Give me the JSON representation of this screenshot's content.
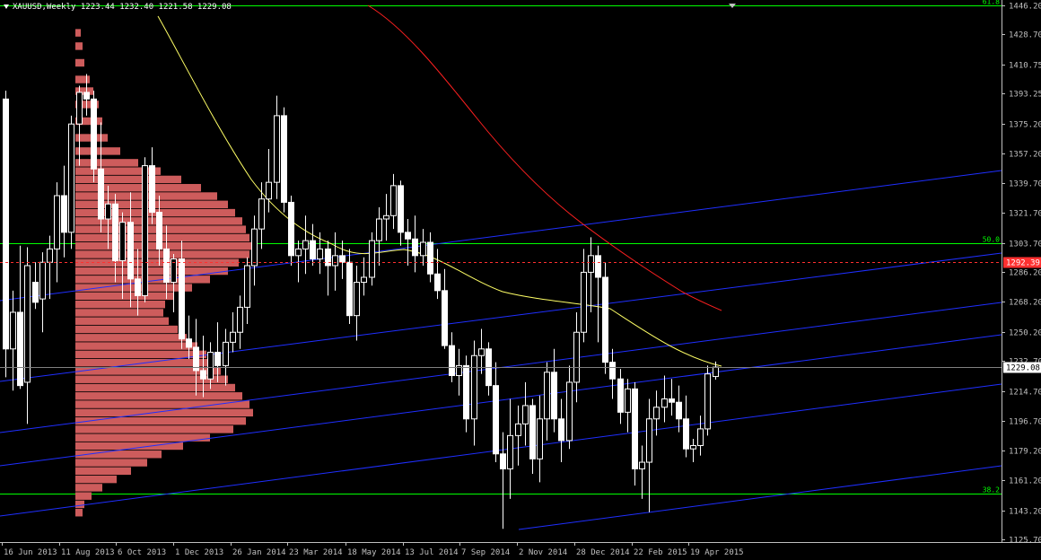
{
  "chart": {
    "symbol_line": "XAUUSD,Weekly  1223.44 1232.40 1221.58 1229.08",
    "colors": {
      "background": "#000000",
      "axis": "#c0c0c0",
      "candle": "#ffffff",
      "volume_profile": "#cd5c5c",
      "ma_fast": "#ffff66",
      "ma_slow": "#ff2020",
      "channel": "#1f2fff",
      "fib": "#00ff00",
      "current_price_line": "#808080",
      "red_dashed": "#ff3030"
    },
    "icons": [
      "dropdown-arrow-icon",
      "scroll-marker-icon"
    ]
  },
  "chart_data": {
    "type": "candlestick",
    "title": "XAUUSD,Weekly",
    "ohlc_last": {
      "open": 1223.44,
      "high": 1232.4,
      "low": 1221.58,
      "close": 1229.08
    },
    "ylim": [
      1125.7,
      1446.2
    ],
    "y_ticks": [
      "1446.20",
      "1428.70",
      "1410.75",
      "1393.25",
      "1375.20",
      "1357.20",
      "1339.70",
      "1321.70",
      "1303.70",
      "1286.20",
      "1268.20",
      "1250.20",
      "1232.70",
      "1214.70",
      "1196.70",
      "1179.20",
      "1161.20",
      "1143.20",
      "1125.70"
    ],
    "x_ticks": [
      "16 Jun 2013",
      "11 Aug 2013",
      "6 Oct 2013",
      "1 Dec 2013",
      "26 Jan 2014",
      "23 Mar 2014",
      "18 May 2014",
      "13 Jul 2014",
      "7 Sep 2014",
      "2 Nov 2014",
      "28 Dec 2014",
      "22 Feb 2015",
      "19 Apr 2015"
    ],
    "price_labels": {
      "current": "1229.08",
      "red": "1292.39"
    },
    "fib_levels": [
      {
        "label": "61.8",
        "price": 1446.2
      },
      {
        "label": "50.0",
        "price": 1303.7
      },
      {
        "label": "38.2",
        "price": 1153.0
      }
    ],
    "candles": [
      {
        "o": 1390,
        "h": 1395,
        "l": 1223,
        "c": 1240
      },
      {
        "o": 1240,
        "h": 1275,
        "l": 1215,
        "c": 1262
      },
      {
        "o": 1262,
        "h": 1302,
        "l": 1216,
        "c": 1218
      },
      {
        "o": 1220,
        "h": 1301,
        "l": 1195,
        "c": 1290
      },
      {
        "o": 1280,
        "h": 1292,
        "l": 1264,
        "c": 1268
      },
      {
        "o": 1270,
        "h": 1298,
        "l": 1250,
        "c": 1292
      },
      {
        "o": 1292,
        "h": 1308,
        "l": 1270,
        "c": 1300
      },
      {
        "o": 1300,
        "h": 1340,
        "l": 1280,
        "c": 1332
      },
      {
        "o": 1332,
        "h": 1350,
        "l": 1295,
        "c": 1310
      },
      {
        "o": 1310,
        "h": 1380,
        "l": 1300,
        "c": 1375
      },
      {
        "o": 1375,
        "h": 1398,
        "l": 1350,
        "c": 1394
      },
      {
        "o": 1394,
        "h": 1405,
        "l": 1380,
        "c": 1390
      },
      {
        "o": 1390,
        "h": 1395,
        "l": 1340,
        "c": 1348
      },
      {
        "o": 1348,
        "h": 1376,
        "l": 1310,
        "c": 1318
      },
      {
        "o": 1318,
        "h": 1338,
        "l": 1300,
        "c": 1327
      },
      {
        "o": 1327,
        "h": 1333,
        "l": 1280,
        "c": 1293
      },
      {
        "o": 1293,
        "h": 1322,
        "l": 1270,
        "c": 1316
      },
      {
        "o": 1316,
        "h": 1334,
        "l": 1265,
        "c": 1282
      },
      {
        "o": 1282,
        "h": 1300,
        "l": 1260,
        "c": 1272
      },
      {
        "o": 1272,
        "h": 1355,
        "l": 1268,
        "c": 1350
      },
      {
        "o": 1350,
        "h": 1361,
        "l": 1315,
        "c": 1322
      },
      {
        "o": 1322,
        "h": 1332,
        "l": 1290,
        "c": 1300
      },
      {
        "o": 1300,
        "h": 1314,
        "l": 1270,
        "c": 1280
      },
      {
        "o": 1280,
        "h": 1297,
        "l": 1262,
        "c": 1294
      },
      {
        "o": 1294,
        "h": 1305,
        "l": 1240,
        "c": 1246
      },
      {
        "o": 1246,
        "h": 1260,
        "l": 1234,
        "c": 1241
      },
      {
        "o": 1241,
        "h": 1258,
        "l": 1212,
        "c": 1227
      },
      {
        "o": 1227,
        "h": 1248,
        "l": 1211,
        "c": 1222
      },
      {
        "o": 1222,
        "h": 1244,
        "l": 1216,
        "c": 1238
      },
      {
        "o": 1238,
        "h": 1256,
        "l": 1220,
        "c": 1230
      },
      {
        "o": 1230,
        "h": 1252,
        "l": 1218,
        "c": 1244
      },
      {
        "o": 1244,
        "h": 1262,
        "l": 1238,
        "c": 1250
      },
      {
        "o": 1250,
        "h": 1272,
        "l": 1240,
        "c": 1265
      },
      {
        "o": 1265,
        "h": 1295,
        "l": 1255,
        "c": 1290
      },
      {
        "o": 1290,
        "h": 1320,
        "l": 1278,
        "c": 1312
      },
      {
        "o": 1312,
        "h": 1340,
        "l": 1300,
        "c": 1330
      },
      {
        "o": 1330,
        "h": 1360,
        "l": 1322,
        "c": 1340
      },
      {
        "o": 1340,
        "h": 1392,
        "l": 1330,
        "c": 1380
      },
      {
        "o": 1380,
        "h": 1385,
        "l": 1322,
        "c": 1328
      },
      {
        "o": 1328,
        "h": 1332,
        "l": 1290,
        "c": 1296
      },
      {
        "o": 1296,
        "h": 1305,
        "l": 1280,
        "c": 1300
      },
      {
        "o": 1300,
        "h": 1320,
        "l": 1285,
        "c": 1305
      },
      {
        "o": 1305,
        "h": 1315,
        "l": 1290,
        "c": 1294
      },
      {
        "o": 1294,
        "h": 1310,
        "l": 1285,
        "c": 1300
      },
      {
        "o": 1300,
        "h": 1305,
        "l": 1272,
        "c": 1290
      },
      {
        "o": 1290,
        "h": 1310,
        "l": 1275,
        "c": 1296
      },
      {
        "o": 1296,
        "h": 1305,
        "l": 1282,
        "c": 1292
      },
      {
        "o": 1292,
        "h": 1300,
        "l": 1255,
        "c": 1260
      },
      {
        "o": 1260,
        "h": 1290,
        "l": 1245,
        "c": 1280
      },
      {
        "o": 1280,
        "h": 1295,
        "l": 1272,
        "c": 1283
      },
      {
        "o": 1283,
        "h": 1310,
        "l": 1278,
        "c": 1305
      },
      {
        "o": 1305,
        "h": 1325,
        "l": 1290,
        "c": 1318
      },
      {
        "o": 1318,
        "h": 1333,
        "l": 1305,
        "c": 1320
      },
      {
        "o": 1320,
        "h": 1345,
        "l": 1312,
        "c": 1338
      },
      {
        "o": 1338,
        "h": 1341,
        "l": 1302,
        "c": 1310
      },
      {
        "o": 1310,
        "h": 1318,
        "l": 1290,
        "c": 1306
      },
      {
        "o": 1306,
        "h": 1320,
        "l": 1286,
        "c": 1296
      },
      {
        "o": 1296,
        "h": 1312,
        "l": 1290,
        "c": 1304
      },
      {
        "o": 1304,
        "h": 1310,
        "l": 1280,
        "c": 1285
      },
      {
        "o": 1285,
        "h": 1300,
        "l": 1270,
        "c": 1275
      },
      {
        "o": 1275,
        "h": 1288,
        "l": 1240,
        "c": 1242
      },
      {
        "o": 1242,
        "h": 1250,
        "l": 1220,
        "c": 1224
      },
      {
        "o": 1224,
        "h": 1240,
        "l": 1212,
        "c": 1230
      },
      {
        "o": 1230,
        "h": 1236,
        "l": 1190,
        "c": 1198
      },
      {
        "o": 1198,
        "h": 1245,
        "l": 1182,
        "c": 1236
      },
      {
        "o": 1236,
        "h": 1252,
        "l": 1225,
        "c": 1240
      },
      {
        "o": 1240,
        "h": 1244,
        "l": 1212,
        "c": 1218
      },
      {
        "o": 1218,
        "h": 1232,
        "l": 1172,
        "c": 1177
      },
      {
        "o": 1177,
        "h": 1190,
        "l": 1132,
        "c": 1168
      },
      {
        "o": 1168,
        "h": 1210,
        "l": 1150,
        "c": 1188
      },
      {
        "o": 1188,
        "h": 1206,
        "l": 1170,
        "c": 1195
      },
      {
        "o": 1195,
        "h": 1220,
        "l": 1182,
        "c": 1206
      },
      {
        "o": 1206,
        "h": 1210,
        "l": 1165,
        "c": 1174
      },
      {
        "o": 1174,
        "h": 1212,
        "l": 1160,
        "c": 1198
      },
      {
        "o": 1198,
        "h": 1232,
        "l": 1185,
        "c": 1226
      },
      {
        "o": 1226,
        "h": 1240,
        "l": 1190,
        "c": 1198
      },
      {
        "o": 1198,
        "h": 1210,
        "l": 1172,
        "c": 1185
      },
      {
        "o": 1185,
        "h": 1230,
        "l": 1180,
        "c": 1220
      },
      {
        "o": 1220,
        "h": 1262,
        "l": 1208,
        "c": 1250
      },
      {
        "o": 1250,
        "h": 1300,
        "l": 1244,
        "c": 1286
      },
      {
        "o": 1286,
        "h": 1307,
        "l": 1262,
        "c": 1296
      },
      {
        "o": 1296,
        "h": 1302,
        "l": 1244,
        "c": 1283
      },
      {
        "o": 1283,
        "h": 1292,
        "l": 1225,
        "c": 1232
      },
      {
        "o": 1232,
        "h": 1240,
        "l": 1210,
        "c": 1222
      },
      {
        "o": 1222,
        "h": 1228,
        "l": 1195,
        "c": 1202
      },
      {
        "o": 1202,
        "h": 1222,
        "l": 1190,
        "c": 1216
      },
      {
        "o": 1216,
        "h": 1220,
        "l": 1158,
        "c": 1168
      },
      {
        "o": 1168,
        "h": 1182,
        "l": 1150,
        "c": 1172
      },
      {
        "o": 1172,
        "h": 1210,
        "l": 1142,
        "c": 1198
      },
      {
        "o": 1198,
        "h": 1215,
        "l": 1188,
        "c": 1205
      },
      {
        "o": 1205,
        "h": 1224,
        "l": 1196,
        "c": 1210
      },
      {
        "o": 1210,
        "h": 1222,
        "l": 1200,
        "c": 1208
      },
      {
        "o": 1208,
        "h": 1218,
        "l": 1190,
        "c": 1198
      },
      {
        "o": 1198,
        "h": 1212,
        "l": 1175,
        "c": 1180
      },
      {
        "o": 1180,
        "h": 1186,
        "l": 1172,
        "c": 1182
      },
      {
        "o": 1182,
        "h": 1200,
        "l": 1176,
        "c": 1192
      },
      {
        "o": 1192,
        "h": 1230,
        "l": 1188,
        "c": 1225
      },
      {
        "o": 1223.44,
        "h": 1232.4,
        "l": 1221.58,
        "c": 1229.08
      }
    ]
  }
}
